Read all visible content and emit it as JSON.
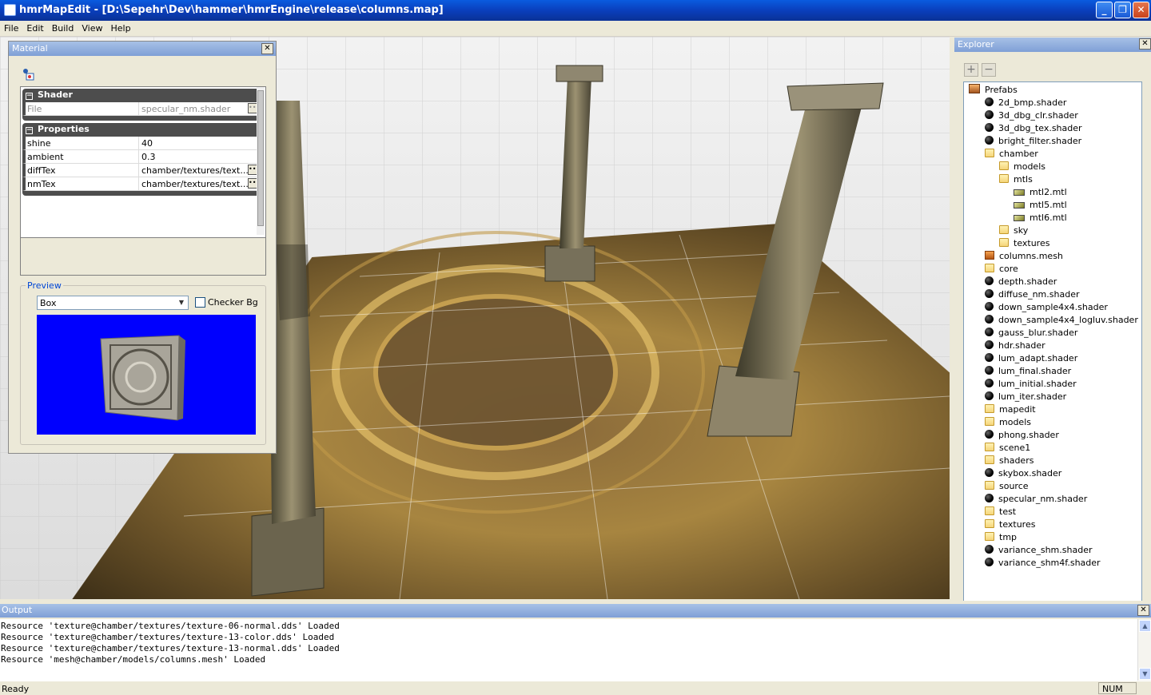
{
  "window": {
    "title": "hmrMapEdit - [D:\\Sepehr\\Dev\\hammer\\hmrEngine\\release\\columns.map]",
    "minimize": "_",
    "restore": "❐",
    "close": "✕"
  },
  "menu": [
    "File",
    "Edit",
    "Build",
    "View",
    "Help"
  ],
  "material": {
    "title": "Material",
    "close": "✕",
    "shader_group": "Shader",
    "shader_file_key": "File",
    "shader_file_value": "specular_nm.shader",
    "properties_group": "Properties",
    "props": [
      {
        "k": "shine",
        "v": "40"
      },
      {
        "k": "ambient",
        "v": "0.3"
      },
      {
        "k": "diffTex",
        "v": "chamber/textures/text..."
      },
      {
        "k": "nmTex",
        "v": "chamber/textures/text..."
      }
    ],
    "preview_label": "Preview",
    "shape": "Box",
    "checker_label": "Checker Bg",
    "preview_bg": "#0000fe"
  },
  "explorer": {
    "title": "Explorer",
    "close": "✕",
    "add": "+",
    "remove": "−",
    "tree": [
      {
        "label": "Prefabs",
        "icon": "prefab",
        "depth": 0
      },
      {
        "label": "2d_bmp.shader",
        "icon": "ball",
        "depth": 1
      },
      {
        "label": "3d_dbg_clr.shader",
        "icon": "ball",
        "depth": 1
      },
      {
        "label": "3d_dbg_tex.shader",
        "icon": "ball",
        "depth": 1
      },
      {
        "label": "bright_filter.shader",
        "icon": "ball",
        "depth": 1
      },
      {
        "label": "chamber",
        "icon": "fold",
        "depth": 1
      },
      {
        "label": "models",
        "icon": "fold",
        "depth": 2
      },
      {
        "label": "mtls",
        "icon": "fold",
        "depth": 2
      },
      {
        "label": "mtl2.mtl",
        "icon": "mtl",
        "depth": 3
      },
      {
        "label": "mtl5.mtl",
        "icon": "mtl",
        "depth": 3
      },
      {
        "label": "mtl6.mtl",
        "icon": "mtl",
        "depth": 3
      },
      {
        "label": "sky",
        "icon": "fold",
        "depth": 2
      },
      {
        "label": "textures",
        "icon": "fold",
        "depth": 2
      },
      {
        "label": "columns.mesh",
        "icon": "mesh",
        "depth": 1
      },
      {
        "label": "core",
        "icon": "fold",
        "depth": 1
      },
      {
        "label": "depth.shader",
        "icon": "ball",
        "depth": 1
      },
      {
        "label": "diffuse_nm.shader",
        "icon": "ball",
        "depth": 1
      },
      {
        "label": "down_sample4x4.shader",
        "icon": "ball",
        "depth": 1
      },
      {
        "label": "down_sample4x4_logluv.shader",
        "icon": "ball",
        "depth": 1
      },
      {
        "label": "gauss_blur.shader",
        "icon": "ball",
        "depth": 1
      },
      {
        "label": "hdr.shader",
        "icon": "ball",
        "depth": 1
      },
      {
        "label": "lum_adapt.shader",
        "icon": "ball",
        "depth": 1
      },
      {
        "label": "lum_final.shader",
        "icon": "ball",
        "depth": 1
      },
      {
        "label": "lum_initial.shader",
        "icon": "ball",
        "depth": 1
      },
      {
        "label": "lum_iter.shader",
        "icon": "ball",
        "depth": 1
      },
      {
        "label": "mapedit",
        "icon": "fold",
        "depth": 1
      },
      {
        "label": "models",
        "icon": "fold",
        "depth": 1
      },
      {
        "label": "phong.shader",
        "icon": "ball",
        "depth": 1
      },
      {
        "label": "scene1",
        "icon": "fold",
        "depth": 1
      },
      {
        "label": "shaders",
        "icon": "fold",
        "depth": 1
      },
      {
        "label": "skybox.shader",
        "icon": "ball",
        "depth": 1
      },
      {
        "label": "source",
        "icon": "fold",
        "depth": 1
      },
      {
        "label": "specular_nm.shader",
        "icon": "ball",
        "depth": 1
      },
      {
        "label": "test",
        "icon": "fold",
        "depth": 1
      },
      {
        "label": "textures",
        "icon": "fold",
        "depth": 1
      },
      {
        "label": "tmp",
        "icon": "fold",
        "depth": 1
      },
      {
        "label": "variance_shm.shader",
        "icon": "ball",
        "depth": 1
      },
      {
        "label": "variance_shm4f.shader",
        "icon": "ball",
        "depth": 1
      }
    ]
  },
  "output": {
    "title": "Output",
    "close": "✕",
    "lines": [
      "Resource 'texture@chamber/textures/texture-06-normal.dds' Loaded",
      "Resource 'texture@chamber/textures/texture-13-color.dds' Loaded",
      "Resource 'texture@chamber/textures/texture-13-normal.dds' Loaded",
      "Resource 'mesh@chamber/models/columns.mesh' Loaded"
    ]
  },
  "status": {
    "text": "Ready",
    "num": "NUM"
  }
}
